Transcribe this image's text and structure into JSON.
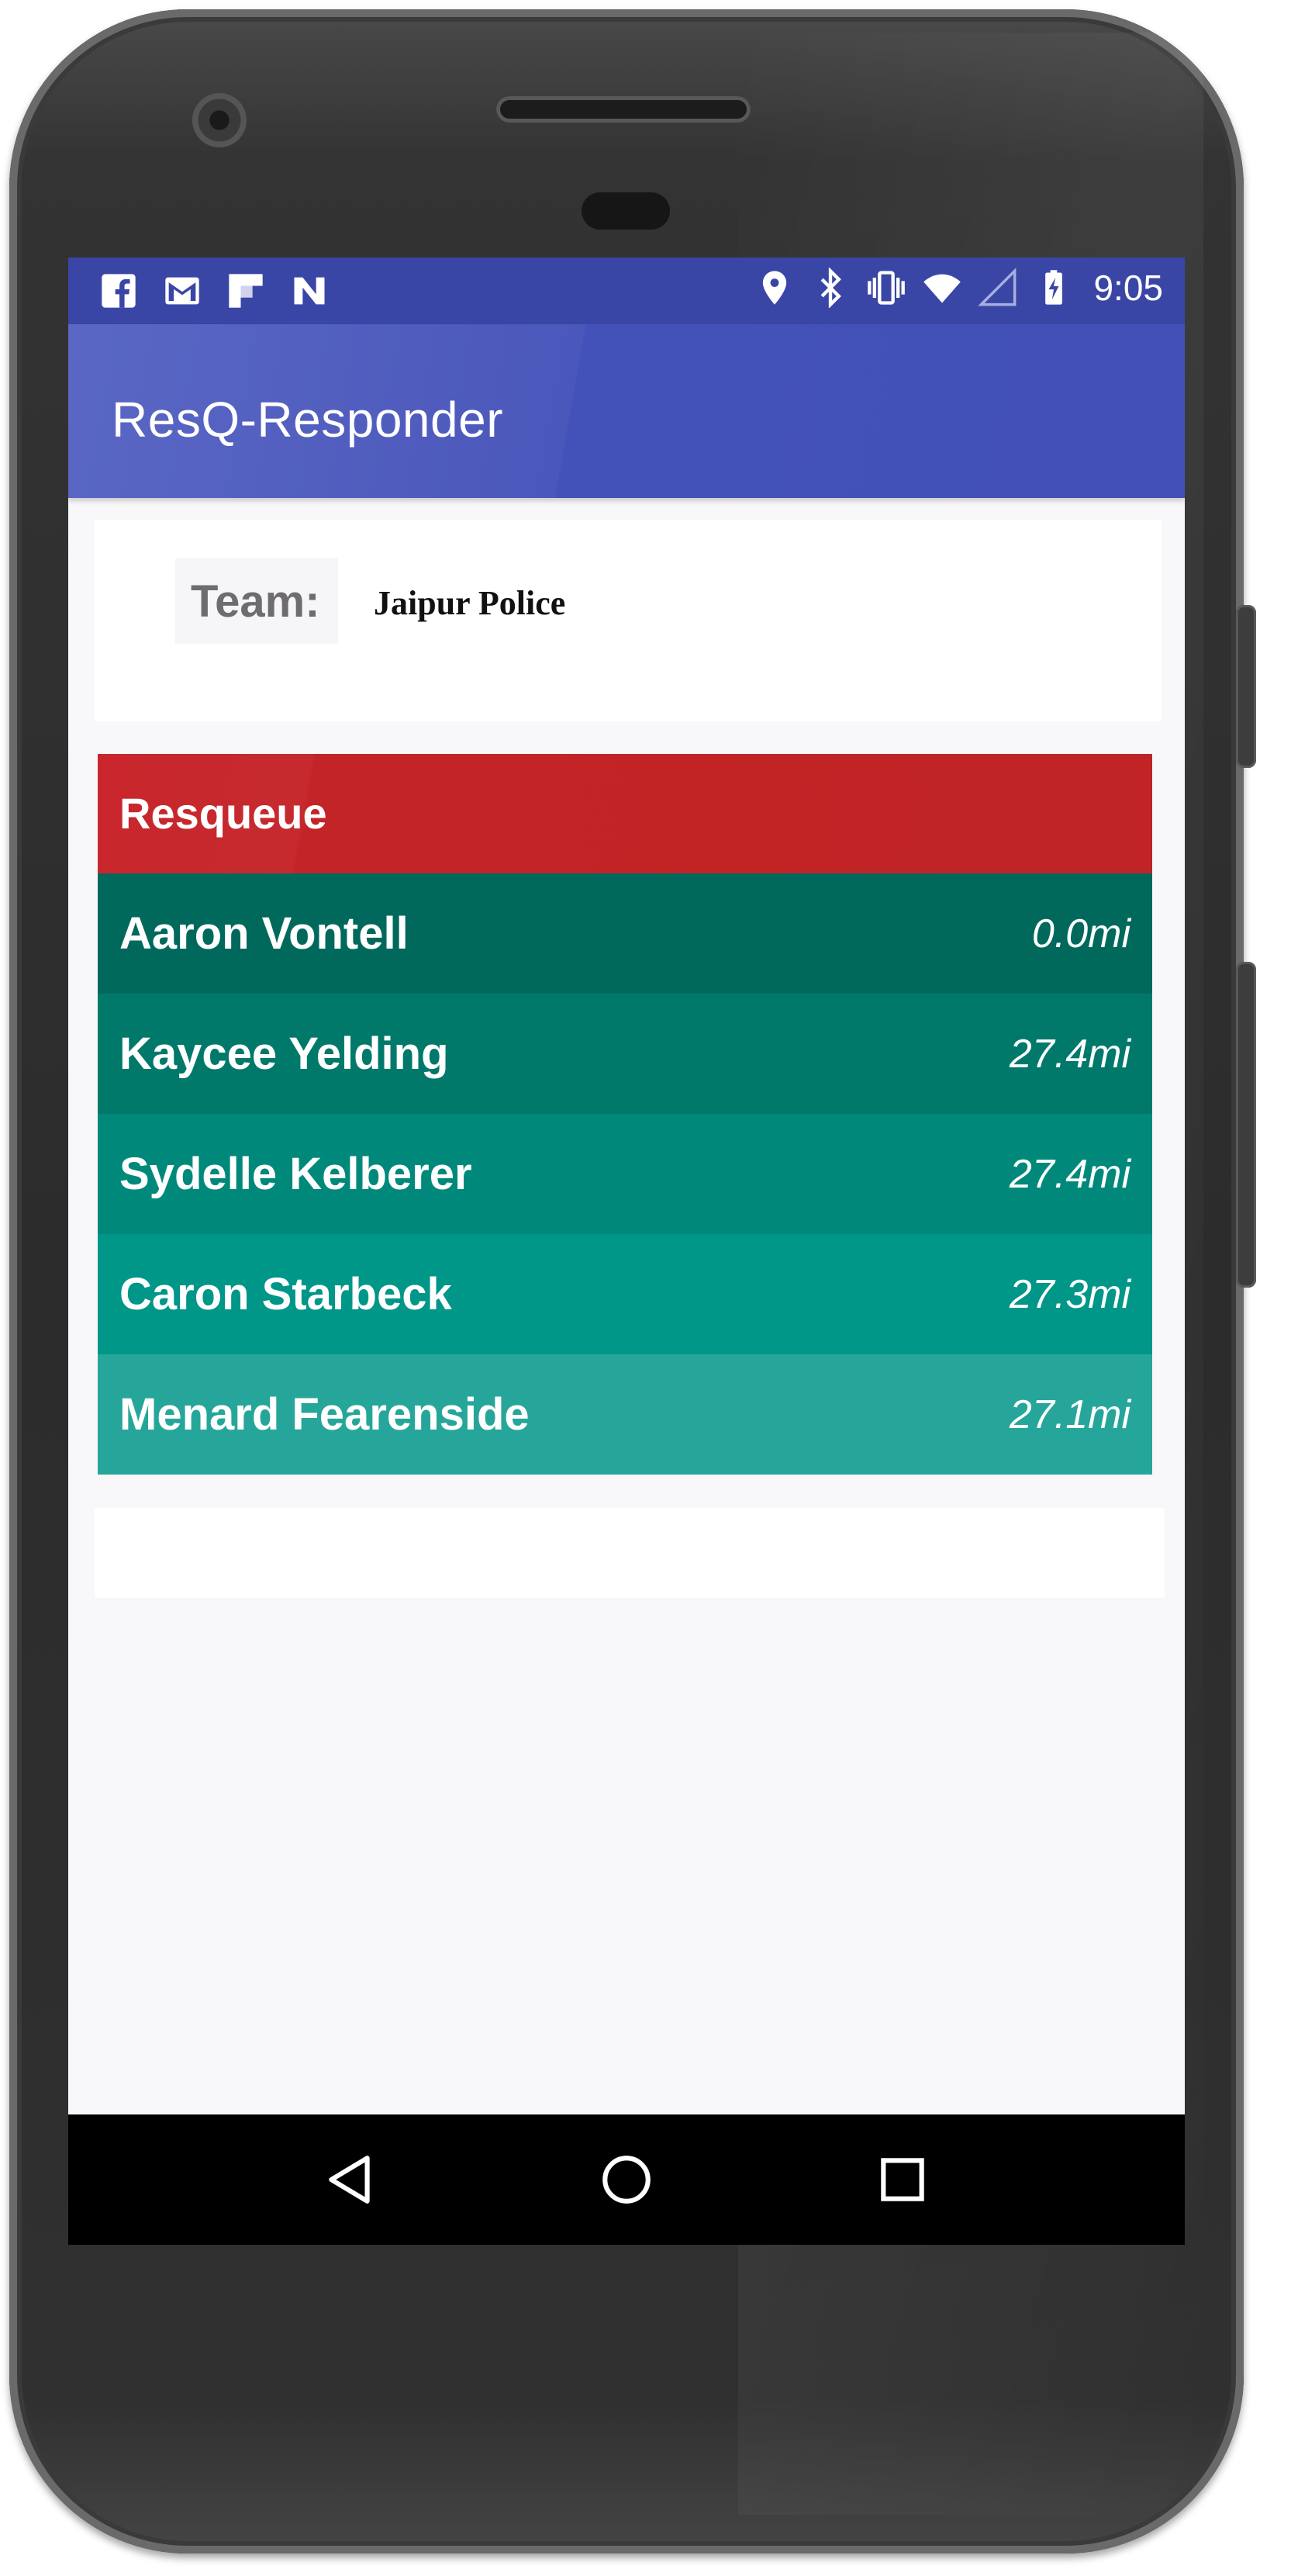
{
  "status_bar": {
    "time": "9:05",
    "left_icons": [
      "facebook-icon",
      "gmail-icon",
      "flipboard-icon",
      "n-app-icon"
    ],
    "right_icons": [
      "location-icon",
      "bluetooth-icon",
      "vibrate-icon",
      "wifi-icon",
      "signal-icon",
      "battery-charging-icon"
    ]
  },
  "app_bar": {
    "title": "ResQ-Responder",
    "color": "#4352b9"
  },
  "team": {
    "label": "Team:",
    "value": "Jaipur Police"
  },
  "queue": {
    "title": "Resqueue",
    "header_color": "#c22427",
    "rows": [
      {
        "name": "Aaron Vontell",
        "distance": "0.0mi",
        "color": "#00695c"
      },
      {
        "name": "Kaycee Yelding",
        "distance": "27.4mi",
        "color": "#00796b"
      },
      {
        "name": "Sydelle Kelberer",
        "distance": "27.4mi",
        "color": "#00897b"
      },
      {
        "name": "Caron Starbeck",
        "distance": "27.3mi",
        "color": "#009688"
      },
      {
        "name": "Menard Fearenside",
        "distance": "27.1mi",
        "color": "#26a69a"
      }
    ]
  },
  "nav_bar": {
    "buttons": [
      "back-icon",
      "home-icon",
      "recents-icon"
    ]
  }
}
